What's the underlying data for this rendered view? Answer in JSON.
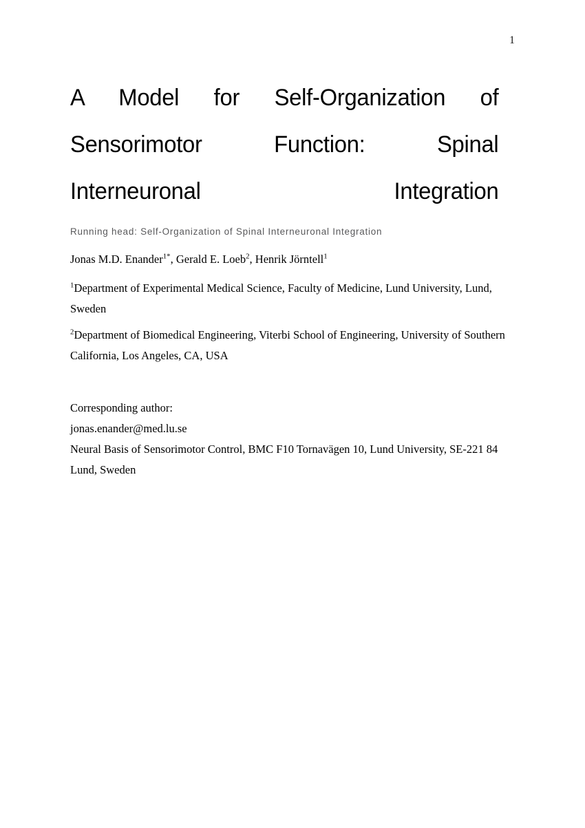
{
  "page": {
    "number": "1",
    "background_color": "#ffffff",
    "text_color": "#000000"
  },
  "title": {
    "text": "A Model for Self-Organization of Sensorimotor Function: Spinal Interneuronal Integration"
  },
  "running_head": {
    "text": "Running head: Self-Organization of Spinal Interneuronal Integration",
    "color": "#59595b"
  },
  "authors": {
    "list": [
      {
        "name": "Jonas M.D. Enander",
        "superscript": "1*"
      },
      {
        "name": "Gerald E. Loeb",
        "superscript": "2"
      },
      {
        "name": "Henrik Jörntell",
        "superscript": "1"
      }
    ],
    "separator": ", "
  },
  "affiliations": [
    {
      "marker": "1",
      "text": "Department of Experimental Medical Science, Faculty of Medicine, Lund University, Lund, Sweden"
    },
    {
      "marker": "2",
      "text": "Department of Biomedical Engineering, Viterbi School of Engineering, University of Southern California, Los Angeles, CA, USA"
    }
  ],
  "corresponding": {
    "label": "Corresponding author:",
    "email": "jonas.enander@med.lu.se",
    "address": "Neural Basis of Sensorimotor Control, BMC F10 Tornavägen 10, Lund University, SE-221 84 Lund, Sweden"
  }
}
